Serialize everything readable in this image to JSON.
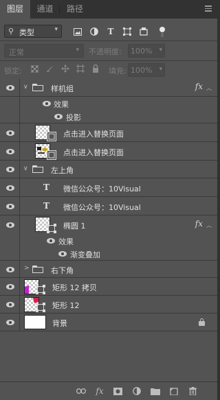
{
  "tabs": [
    {
      "label": "图层"
    },
    {
      "label": "通道"
    },
    {
      "label": "路径"
    }
  ],
  "filter": {
    "kind_label": "类型",
    "blend_mode": "正常",
    "opacity_label": "不透明度:",
    "opacity_value": "100%",
    "lock_label": "锁定:",
    "fill_label": "填充:",
    "fill_value": "100%"
  },
  "layers": [
    {
      "name": "样机组",
      "type": "group",
      "expanded": true,
      "fx": true
    },
    {
      "name": "效果",
      "type": "effects"
    },
    {
      "name": "投影",
      "type": "effect"
    },
    {
      "name": "点击进入替换页面",
      "type": "smart-object"
    },
    {
      "name": "点击进入替换页面",
      "type": "smart-object"
    },
    {
      "name": "左上角",
      "type": "group",
      "expanded": true
    },
    {
      "name": "微信公众号：10Visual",
      "type": "text"
    },
    {
      "name": "微信公众号：10Visual",
      "type": "text"
    },
    {
      "name": "椭圆 1",
      "type": "shape",
      "fx": true
    },
    {
      "name": "效果",
      "type": "effects"
    },
    {
      "name": "渐变叠加",
      "type": "effect"
    },
    {
      "name": "右下角",
      "type": "group",
      "expanded": false
    },
    {
      "name": "矩形 12 拷贝",
      "type": "shape"
    },
    {
      "name": "矩形 12",
      "type": "shape"
    },
    {
      "name": "背景",
      "type": "background",
      "locked": true
    }
  ],
  "fx_symbol": "fx",
  "colors": {
    "panel_bg": "#535353",
    "tab_bar_bg": "#323232",
    "text": "#e2e2e2",
    "disabled_text": "#7c7c7c"
  }
}
